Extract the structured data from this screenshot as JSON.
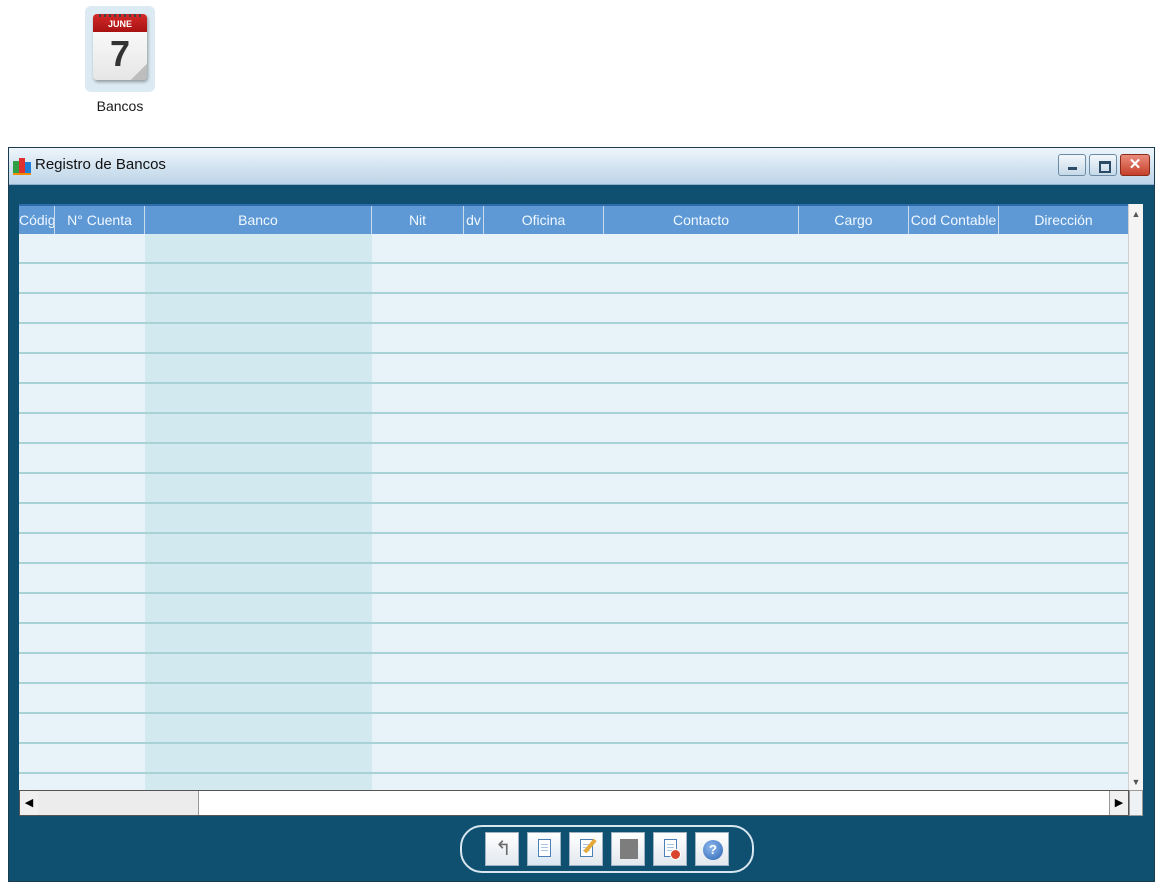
{
  "desktop": {
    "icon_label": "Bancos",
    "calendar_month": "JUNE",
    "calendar_day": "7"
  },
  "window": {
    "title": "Registro de Bancos",
    "controls": {
      "minimize": "minimize-icon",
      "maximize": "maximize-icon",
      "close": "✕"
    }
  },
  "grid": {
    "columns": [
      {
        "key": "codigo",
        "label": "Códig"
      },
      {
        "key": "cuenta",
        "label": "N° Cuenta"
      },
      {
        "key": "banco",
        "label": "Banco"
      },
      {
        "key": "nit",
        "label": "Nit"
      },
      {
        "key": "dv",
        "label": "dv"
      },
      {
        "key": "oficina",
        "label": "Oficina"
      },
      {
        "key": "contacto",
        "label": "Contacto"
      },
      {
        "key": "cargo",
        "label": "Cargo"
      },
      {
        "key": "cod_contable",
        "label": "Cod Contable"
      },
      {
        "key": "direccion",
        "label": "Dirección"
      }
    ],
    "rows": [],
    "header_color": "#5e99d6",
    "row_color": "#e8f2f9",
    "banco_column_color": "#d2e9ef"
  },
  "scrollbar": {
    "up_arrow": "▲",
    "down_arrow": "▼",
    "left_arrow": "◀",
    "right_arrow": "▶"
  },
  "toolbar": {
    "buttons": [
      {
        "name": "back",
        "icon": "undo-arrow-icon",
        "glyph": "↰"
      },
      {
        "name": "new",
        "icon": "new-document-icon"
      },
      {
        "name": "edit",
        "icon": "edit-document-icon"
      },
      {
        "name": "stop",
        "icon": "gray-square-icon"
      },
      {
        "name": "delete",
        "icon": "delete-document-icon"
      },
      {
        "name": "help",
        "icon": "help-icon",
        "glyph": "?"
      }
    ]
  }
}
